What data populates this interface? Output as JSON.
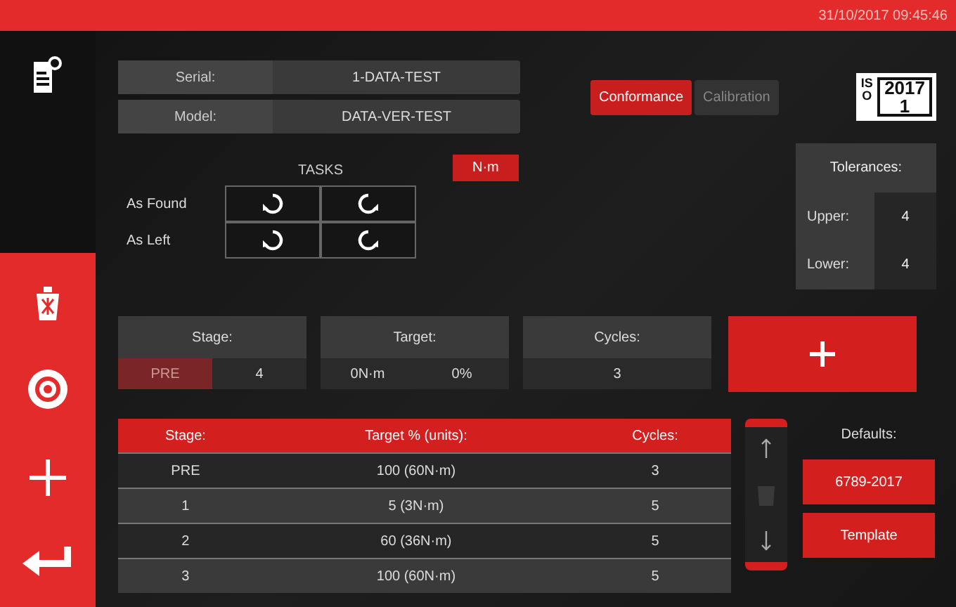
{
  "status_bar": {
    "datetime": "31/10/2017 09:45:46"
  },
  "device": {
    "fields": [
      {
        "label": "Serial:",
        "value": "1-DATA-TEST"
      },
      {
        "label": "Model:",
        "value": "DATA-VER-TEST"
      }
    ]
  },
  "modes": [
    {
      "label": "Conformance",
      "selected": true
    },
    {
      "label": "Calibration",
      "selected": false
    }
  ],
  "iso_badge": {
    "letters": "ISO",
    "year": "2017",
    "part": "1"
  },
  "tasks": {
    "title": "TASKS",
    "rows": [
      {
        "label": "As Found"
      },
      {
        "label": "As Left"
      }
    ]
  },
  "units": [
    {
      "label": "N·m",
      "selected": true
    }
  ],
  "tolerances": {
    "title": "Tolerances:",
    "fields": [
      {
        "label": "Upper:",
        "value": "4"
      },
      {
        "label": "Lower:",
        "value": "4"
      }
    ]
  },
  "stage_editor": [
    {
      "title": "Stage:",
      "values": [
        {
          "text": "PRE",
          "selected": true
        },
        {
          "text": "4",
          "selected": false
        }
      ]
    },
    {
      "title": "Target:",
      "values": [
        {
          "text": "0N·m",
          "selected": false
        },
        {
          "text": "0%",
          "selected": false
        }
      ]
    },
    {
      "title": "Cycles:",
      "values": [
        {
          "text": "3",
          "selected": false
        }
      ]
    }
  ],
  "table": {
    "columns": [
      "Stage:",
      "Target % (units):",
      "Cycles:"
    ],
    "rows": [
      [
        "PRE",
        "100 (60N·m)",
        "3"
      ],
      [
        "1",
        "5 (3N·m)",
        "5"
      ],
      [
        "2",
        "60 (36N·m)",
        "5"
      ],
      [
        "3",
        "100 (60N·m)",
        "5"
      ]
    ]
  },
  "defaults": {
    "title": "Defaults:",
    "buttons": [
      "6789-2017",
      "Template"
    ]
  }
}
